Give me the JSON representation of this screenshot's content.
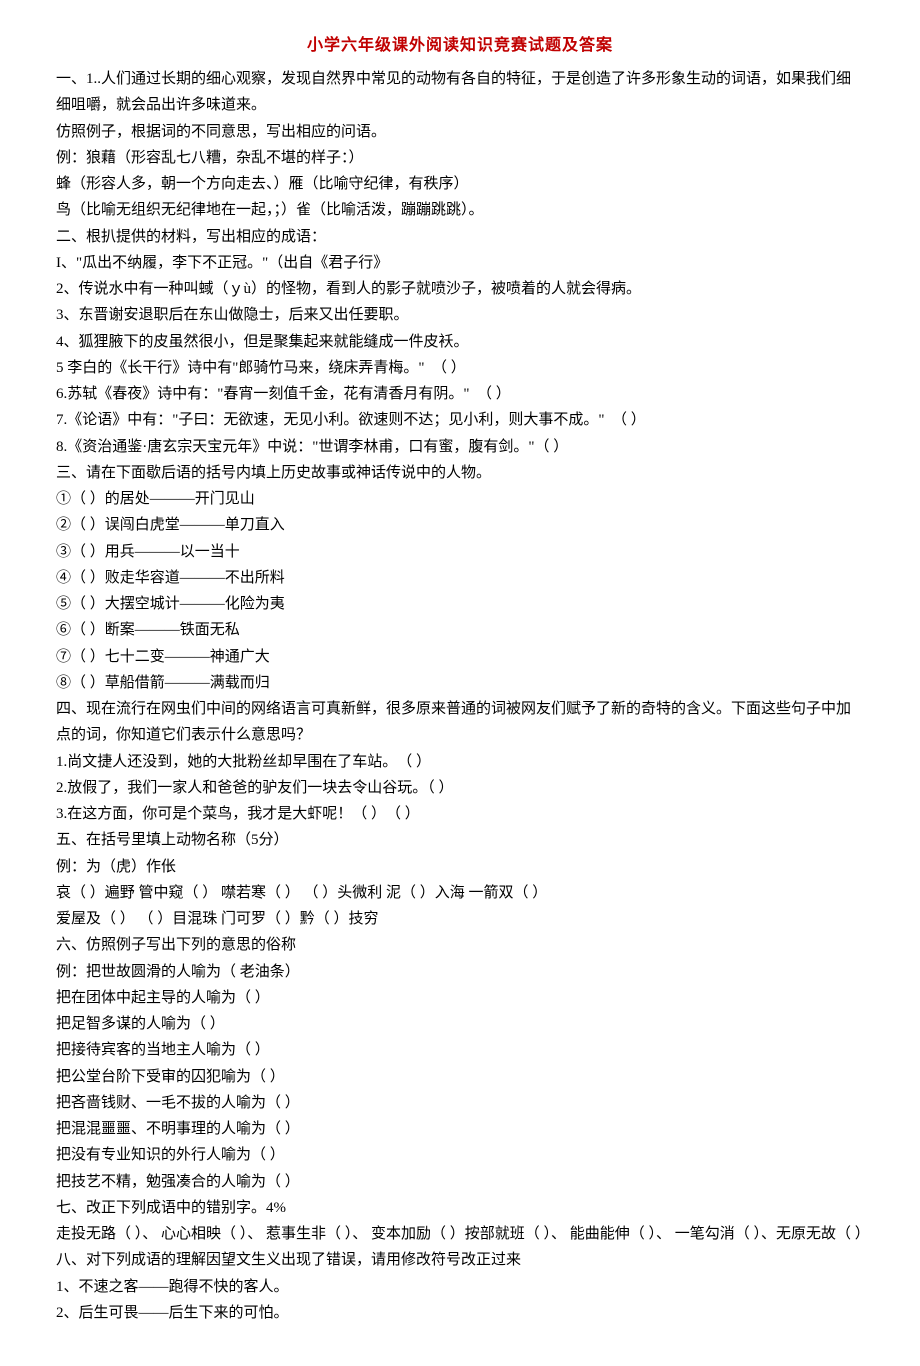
{
  "title": "小学六年级课外阅读知识竞赛试题及答案",
  "lines": [
    "一、1..人们通过长期的细心观察，发现自然界中常见的动物有各自的特征，于是创造了许多形象生动的词语，如果我们细细咀嚼，就会品出许多味道来。",
    "仿照例子，根据词的不同意思，写出相应的问语。",
    "例：狼藉（形容乱七八糟，杂乱不堪的样子：）",
    "蜂（形容人多，朝一个方向走去、）雁（比喻守纪律，有秩序）",
    "鸟（比喻无组织无纪律地在一起，；）雀（比喻活泼，蹦蹦跳跳）。",
    "二、根扒提供的材料，写出相应的成语：",
    "I、\"瓜出不纳履，李下不正冠。\"（出自《君子行》",
    "2、传说水中有一种叫蜮（ｙù）的怪物，看到人的影子就喷沙子，被喷着的人就会得病。",
    "3、东晋谢安退职后在东山做隐士，后来又出任要职。",
    "4、狐狸腋下的皮虽然很小，但是聚集起来就能缝成一件皮袄。",
    "5 李白的《长干行》诗中有\"郎骑竹马来，绕床弄青梅。\"　（ ）",
    "6.苏轼《春夜》诗中有：\"春宵一刻值千金，花有清香月有阴。\"　（ ）",
    "7.《论语》中有：\"子曰：无欲速，无见小利。欲速则不达；见小利，则大事不成。\"　（ ）",
    "8.《资治通鉴·唐玄宗天宝元年》中说：\"世谓李林甫，口有蜜，腹有剑。\"（ ）",
    "三、请在下面歇后语的括号内填上历史故事或神话传说中的人物。",
    "①（ ）的居处———开门见山",
    "②（ ）误闯白虎堂———单刀直入",
    "③（ ）用兵———以一当十",
    "④（ ）败走华容道———不出所料",
    "⑤（ ）大摆空城计———化险为夷",
    "⑥（ ）断案———铁面无私",
    "⑦（ ）七十二变———神通广大",
    "⑧（ ）草船借箭———满载而归",
    "四、现在流行在网虫们中间的网络语言可真新鲜，很多原来普通的词被网友们赋予了新的奇特的含义。下面这些句子中加点的词，你知道它们表示什么意思吗？",
    "1.尚文捷人还没到，她的大批粉丝却早围在了车站。　（ ）",
    "2.放假了，我们一家人和爸爸的驴友们一块去令山谷玩。（ ）",
    "3.在这方面，你可是个菜鸟，我才是大虾呢！（ ）　（ ）",
    "五、在括号里填上动物名称（5分）",
    "例：为（虎）作伥",
    "哀（ ）遍野 管中窥（ ） 噤若寒（ ） （ ）头微利 泥（ ）入海 一箭双（ ）",
    "爱屋及（ ） （ ）目混珠 门可罗（ ）黔（ ）技穷",
    "六、仿照例子写出下列的意思的俗称",
    "例：把世故圆滑的人喻为（ 老油条）",
    "把在团体中起主导的人喻为（ ）",
    "把足智多谋的人喻为（ ）",
    "把接待宾客的当地主人喻为（ ）",
    "把公堂台阶下受审的囚犯喻为（ ）",
    "把吝啬钱财、一毛不拔的人喻为（ ）",
    "把混混噩噩、不明事理的人喻为（ ）",
    "把没有专业知识的外行人喻为（ ）",
    "把技艺不精，勉强凑合的人喻为（ ）",
    "七、改正下列成语中的错别字。4%",
    "走投无路（ ）、 心心相映（ ）、 惹事生非（ ）、 变本加励（ ）按部就班（ ）、 能曲能伸（ ）、 一笔勾消（ ）、无原无故（ ）",
    "八、对下列成语的理解因望文生义出现了错误，请用修改符号改正过来",
    "1、不速之客——跑得不快的客人。",
    "2、后生可畏——后生下来的可怕。"
  ]
}
